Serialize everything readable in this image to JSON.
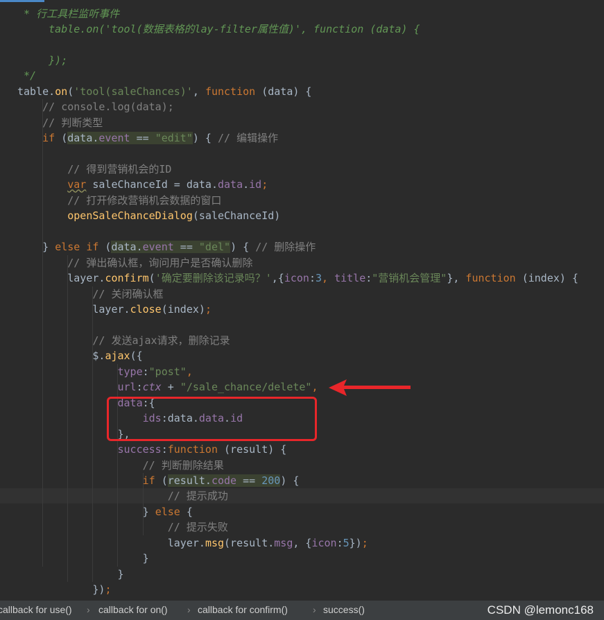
{
  "code_lines": [
    [
      {
        "t": " * 行工具栏监听事件",
        "c": "doc"
      }
    ],
    [
      {
        "t": "     table.on('tool(数据表格的lay-filter属性值)', function (data) {",
        "c": "doc"
      }
    ],
    [
      {
        "t": "",
        "c": ""
      }
    ],
    [
      {
        "t": "     });",
        "c": "doc"
      }
    ],
    [
      {
        "t": " */",
        "c": "doc"
      }
    ],
    [
      {
        "t": "table.",
        "c": ""
      },
      {
        "t": "on",
        "c": "fn"
      },
      {
        "t": "(",
        "c": ""
      },
      {
        "t": "'tool(saleChances)'",
        "c": "str"
      },
      {
        "t": ", ",
        "c": ""
      },
      {
        "t": "function",
        "c": "kw"
      },
      {
        "t": " (data) {",
        "c": ""
      }
    ],
    [
      {
        "t": "    // console.log(data);",
        "c": "com"
      }
    ],
    [
      {
        "t": "    // 判断类型",
        "c": "com"
      }
    ],
    [
      {
        "t": "    ",
        "c": ""
      },
      {
        "t": "if",
        "c": "kw"
      },
      {
        "t": " (",
        "c": ""
      },
      {
        "t": "data.",
        "c": "hl"
      },
      {
        "t": "event",
        "c": "prop hl"
      },
      {
        "t": " == ",
        "c": "hl"
      },
      {
        "t": "\"edit\"",
        "c": "str hl"
      },
      {
        "t": ") { ",
        "c": ""
      },
      {
        "t": "// 编辑操作",
        "c": "com"
      }
    ],
    [
      {
        "t": "",
        "c": ""
      }
    ],
    [
      {
        "t": "        // 得到营销机会的ID",
        "c": "com"
      }
    ],
    [
      {
        "t": "        ",
        "c": ""
      },
      {
        "t": "var",
        "c": "kw wavy"
      },
      {
        "t": " saleChanceId = data.",
        "c": ""
      },
      {
        "t": "data",
        "c": "prop"
      },
      {
        "t": ".",
        "c": ""
      },
      {
        "t": "id",
        "c": "prop"
      },
      {
        "t": ";",
        "c": "kw"
      }
    ],
    [
      {
        "t": "        // 打开修改营销机会数据的窗口",
        "c": "com"
      }
    ],
    [
      {
        "t": "        ",
        "c": ""
      },
      {
        "t": "openSaleChanceDialog",
        "c": "fn"
      },
      {
        "t": "(saleChanceId)",
        "c": ""
      }
    ],
    [
      {
        "t": "",
        "c": ""
      }
    ],
    [
      {
        "t": "    } ",
        "c": ""
      },
      {
        "t": "else if",
        "c": "kw"
      },
      {
        "t": " (",
        "c": ""
      },
      {
        "t": "data.",
        "c": "hl"
      },
      {
        "t": "event",
        "c": "prop hl"
      },
      {
        "t": " == ",
        "c": "hl"
      },
      {
        "t": "\"del\"",
        "c": "str hl"
      },
      {
        "t": ") { ",
        "c": ""
      },
      {
        "t": "// 删除操作",
        "c": "com"
      }
    ],
    [
      {
        "t": "        // 弹出确认框，询问用户是否确认删除",
        "c": "com"
      }
    ],
    [
      {
        "t": "        layer.",
        "c": ""
      },
      {
        "t": "confirm",
        "c": "fn"
      },
      {
        "t": "(",
        "c": ""
      },
      {
        "t": "'确定要删除该记录吗？'",
        "c": "str"
      },
      {
        "t": ",{",
        "c": ""
      },
      {
        "t": "icon",
        "c": "prop"
      },
      {
        "t": ":",
        "c": ""
      },
      {
        "t": "3",
        "c": "num"
      },
      {
        "t": ", ",
        "c": "kw"
      },
      {
        "t": "title",
        "c": "prop"
      },
      {
        "t": ":",
        "c": ""
      },
      {
        "t": "\"营销机会管理\"",
        "c": "str"
      },
      {
        "t": "}, ",
        "c": ""
      },
      {
        "t": "function",
        "c": "kw"
      },
      {
        "t": " (index) {",
        "c": ""
      }
    ],
    [
      {
        "t": "            // 关闭确认框",
        "c": "com"
      }
    ],
    [
      {
        "t": "            layer.",
        "c": ""
      },
      {
        "t": "close",
        "c": "fn"
      },
      {
        "t": "(index)",
        "c": ""
      },
      {
        "t": ";",
        "c": "kw"
      }
    ],
    [
      {
        "t": "",
        "c": ""
      }
    ],
    [
      {
        "t": "            // 发送ajax请求，删除记录",
        "c": "com"
      }
    ],
    [
      {
        "t": "            $.",
        "c": ""
      },
      {
        "t": "ajax",
        "c": "fn"
      },
      {
        "t": "({",
        "c": ""
      }
    ],
    [
      {
        "t": "                ",
        "c": ""
      },
      {
        "t": "type",
        "c": "prop"
      },
      {
        "t": ":",
        "c": ""
      },
      {
        "t": "\"post\"",
        "c": "str"
      },
      {
        "t": ",",
        "c": "kw"
      }
    ],
    [
      {
        "t": "                ",
        "c": ""
      },
      {
        "t": "url",
        "c": "prop"
      },
      {
        "t": ":",
        "c": ""
      },
      {
        "t": "ctx",
        "c": "var-i"
      },
      {
        "t": " + ",
        "c": ""
      },
      {
        "t": "\"/sale_chance/delete\"",
        "c": "str"
      },
      {
        "t": ",",
        "c": "kw"
      }
    ],
    [
      {
        "t": "                ",
        "c": ""
      },
      {
        "t": "data",
        "c": "prop"
      },
      {
        "t": ":{",
        "c": ""
      }
    ],
    [
      {
        "t": "                    ",
        "c": ""
      },
      {
        "t": "ids",
        "c": "prop"
      },
      {
        "t": ":data.",
        "c": ""
      },
      {
        "t": "data",
        "c": "prop"
      },
      {
        "t": ".",
        "c": ""
      },
      {
        "t": "id",
        "c": "prop"
      }
    ],
    [
      {
        "t": "                },",
        "c": ""
      }
    ],
    [
      {
        "t": "                ",
        "c": ""
      },
      {
        "t": "success",
        "c": "prop"
      },
      {
        "t": ":",
        "c": ""
      },
      {
        "t": "function",
        "c": "kw"
      },
      {
        "t": " (result) {",
        "c": ""
      }
    ],
    [
      {
        "t": "                    // 判断删除结果",
        "c": "com"
      }
    ],
    [
      {
        "t": "                    ",
        "c": ""
      },
      {
        "t": "if",
        "c": "kw"
      },
      {
        "t": " (",
        "c": ""
      },
      {
        "t": "result.",
        "c": "hl"
      },
      {
        "t": "code",
        "c": "prop hl"
      },
      {
        "t": " == ",
        "c": "hl"
      },
      {
        "t": "200",
        "c": "num hl"
      },
      {
        "t": ") {",
        "c": ""
      }
    ],
    [
      {
        "t": "                        // 提示成功",
        "c": "com"
      }
    ],
    [
      {
        "t": "                    } ",
        "c": ""
      },
      {
        "t": "else",
        "c": "kw"
      },
      {
        "t": " {",
        "c": ""
      }
    ],
    [
      {
        "t": "                        // 提示失败",
        "c": "com"
      }
    ],
    [
      {
        "t": "                        layer.",
        "c": ""
      },
      {
        "t": "msg",
        "c": "fn"
      },
      {
        "t": "(result.",
        "c": ""
      },
      {
        "t": "msg",
        "c": "prop"
      },
      {
        "t": ", {",
        "c": ""
      },
      {
        "t": "icon",
        "c": "prop"
      },
      {
        "t": ":",
        "c": ""
      },
      {
        "t": "5",
        "c": "num"
      },
      {
        "t": "})",
        "c": ""
      },
      {
        "t": ";",
        "c": "kw"
      }
    ],
    [
      {
        "t": "                    }",
        "c": ""
      }
    ],
    [
      {
        "t": "                }",
        "c": ""
      }
    ],
    [
      {
        "t": "            })",
        "c": ""
      },
      {
        "t": ";",
        "c": "kw"
      }
    ]
  ],
  "current_line_index": 31,
  "breadcrumbs": [
    "callback for use()",
    "callback for on()",
    "callback for confirm()",
    "success()"
  ],
  "watermark": "CSDN @lemonc168",
  "colors": {
    "annotation_box": "#e8262a",
    "annotation_arrow": "#e8262a"
  }
}
